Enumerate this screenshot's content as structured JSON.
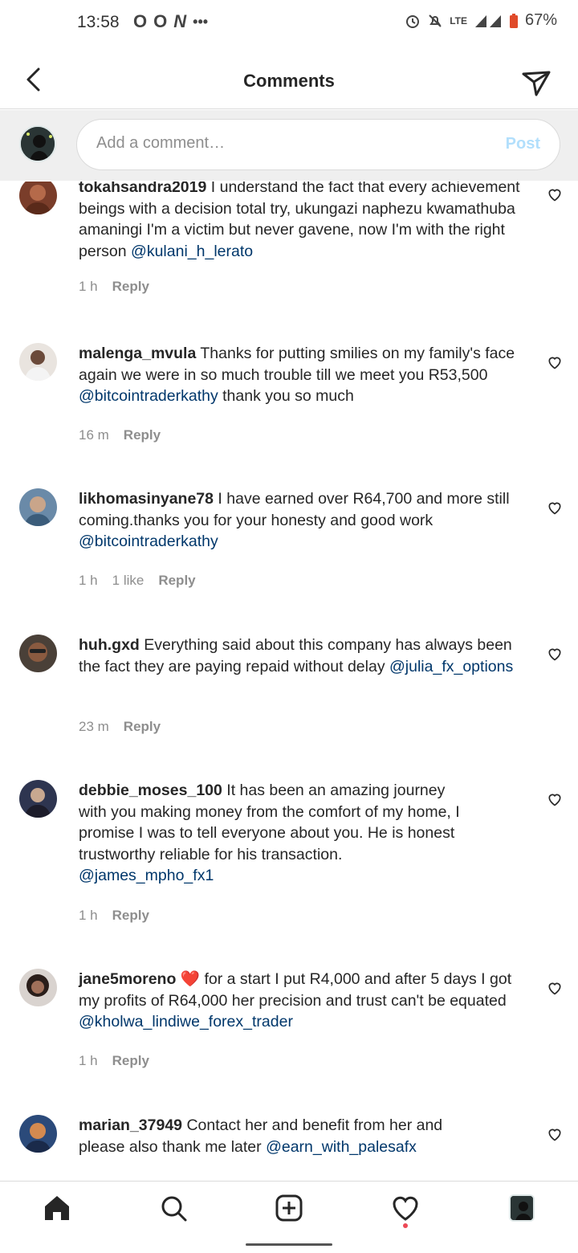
{
  "status_bar": {
    "time": "13:58",
    "app_icons": [
      "O",
      "O",
      "N",
      "•••"
    ],
    "network": "LTE",
    "battery": "67%"
  },
  "header": {
    "title": "Comments",
    "back_icon": "chevron-left-icon",
    "send_icon": "paper-plane-icon"
  },
  "comment_input": {
    "placeholder": "Add a comment…",
    "post_label": "Post"
  },
  "comments": [
    {
      "username": "tokahsandra2019",
      "text": " I understand the fact that every achievement beings with a decision total try, ukungazi naphezu kwamathuba amaningi I'm a victim but never gavene, now I'm with the right person ",
      "mention": "@kulani_h_lerato",
      "time": "1 h",
      "likes": "",
      "reply": "Reply",
      "avatar_color": "#7a3d2a"
    },
    {
      "username": "malenga_mvula",
      "text": " Thanks for putting smilies on my family's face again we were in so much trouble till we meet you R53,500 ",
      "mention": "@bitcointraderkathy",
      "after": " thank you so much",
      "time": "16 m",
      "likes": "",
      "reply": "Reply",
      "avatar_color": "#c9b7a8"
    },
    {
      "username": "likhomasinyane78",
      "text": " I have earned over R64,700 and more still coming.thanks you for your honesty and good work ",
      "mention": "@bitcointraderkathy",
      "time": "1 h",
      "likes": "1 like",
      "reply": "Reply",
      "avatar_color": "#6a8aa8"
    },
    {
      "username": "huh.gxd",
      "text": " Everything said about this company has always been the fact they are paying repaid without delay ",
      "mention": "@julia_fx_options",
      "time": "23 m",
      "likes": "",
      "reply": "Reply",
      "avatar_color": "#4a4038"
    },
    {
      "username": "debbie_moses_100",
      "text": " It has been an amazing journey with you making money from the comfort of my home, I promise I was to tell everyone about you. He is honest trustworthy reliable for his transaction. ",
      "mention": "@james_mpho_fx1",
      "time": "1 h",
      "likes": "",
      "reply": "Reply",
      "avatar_color": "#2e3550"
    },
    {
      "username": "jane5moreno",
      "text": " ❤️ for a start I put R4,000 and after 5 days I got my profits of R64,000 her precision and trust can't be equated ",
      "mention": "@kholwa_lindiwe_forex_trader",
      "time": "1 h",
      "likes": "",
      "reply": "Reply",
      "avatar_color": "#3a2c28"
    },
    {
      "username": "marian_37949",
      "text": " Contact her and benefit from her and please also thank me later ",
      "mention": "@earn_with_palesafx",
      "time": "",
      "likes": "",
      "reply": "",
      "avatar_color": "#2b4a7a"
    }
  ],
  "bottom_nav": {
    "items": [
      "home-icon",
      "search-icon",
      "add-post-icon",
      "heart-icon",
      "profile-icon"
    ]
  }
}
